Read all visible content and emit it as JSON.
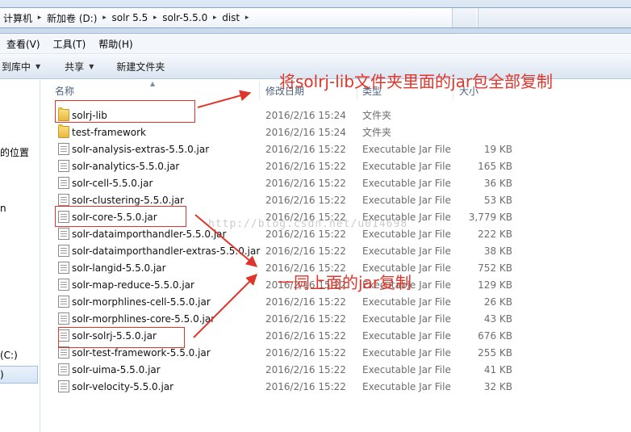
{
  "address_bar": {
    "crumbs": [
      "计算机",
      "新加卷 (D:)",
      "solr 5.5",
      "solr-5.5.0",
      "dist"
    ]
  },
  "menu": [
    "查看(V)",
    "工具(T)",
    "帮助(H)"
  ],
  "toolbar": {
    "include_in_library": "到库中",
    "share": "共享",
    "new_folder": "新建文件夹"
  },
  "nav_fragments": [
    "的位置",
    "n",
    "(C:)"
  ],
  "columns": {
    "name": "名称",
    "date": "修改日期",
    "type": "类型",
    "size": "大小"
  },
  "files": [
    {
      "name": "solrj-lib",
      "date": "2016/2/16 15:24",
      "type": "文件夹",
      "size": "",
      "kind": "folder"
    },
    {
      "name": "test-framework",
      "date": "2016/2/16 15:24",
      "type": "文件夹",
      "size": "",
      "kind": "folder"
    },
    {
      "name": "solr-analysis-extras-5.5.0.jar",
      "date": "2016/2/16 15:22",
      "type": "Executable Jar File",
      "size": "19 KB",
      "kind": "jar"
    },
    {
      "name": "solr-analytics-5.5.0.jar",
      "date": "2016/2/16 15:22",
      "type": "Executable Jar File",
      "size": "165 KB",
      "kind": "jar"
    },
    {
      "name": "solr-cell-5.5.0.jar",
      "date": "2016/2/16 15:22",
      "type": "Executable Jar File",
      "size": "36 KB",
      "kind": "jar"
    },
    {
      "name": "solr-clustering-5.5.0.jar",
      "date": "2016/2/16 15:22",
      "type": "Executable Jar File",
      "size": "53 KB",
      "kind": "jar"
    },
    {
      "name": "solr-core-5.5.0.jar",
      "date": "2016/2/16 15:22",
      "type": "Executable Jar File",
      "size": "3,779 KB",
      "kind": "jar"
    },
    {
      "name": "solr-dataimporthandler-5.5.0.jar",
      "date": "2016/2/16 15:22",
      "type": "Executable Jar File",
      "size": "222 KB",
      "kind": "jar"
    },
    {
      "name": "solr-dataimporthandler-extras-5.5.0.jar",
      "date": "2016/2/16 15:22",
      "type": "Executable Jar File",
      "size": "38 KB",
      "kind": "jar"
    },
    {
      "name": "solr-langid-5.5.0.jar",
      "date": "2016/2/16 15:22",
      "type": "Executable Jar File",
      "size": "752 KB",
      "kind": "jar"
    },
    {
      "name": "solr-map-reduce-5.5.0.jar",
      "date": "2016/2/16 15:22",
      "type": "Executable Jar File",
      "size": "129 KB",
      "kind": "jar"
    },
    {
      "name": "solr-morphlines-cell-5.5.0.jar",
      "date": "2016/2/16 15:22",
      "type": "Executable Jar File",
      "size": "26 KB",
      "kind": "jar"
    },
    {
      "name": "solr-morphlines-core-5.5.0.jar",
      "date": "2016/2/16 15:22",
      "type": "Executable Jar File",
      "size": "43 KB",
      "kind": "jar"
    },
    {
      "name": "solr-solrj-5.5.0.jar",
      "date": "2016/2/16 15:22",
      "type": "Executable Jar File",
      "size": "676 KB",
      "kind": "jar"
    },
    {
      "name": "solr-test-framework-5.5.0.jar",
      "date": "2016/2/16 15:22",
      "type": "Executable Jar File",
      "size": "255 KB",
      "kind": "jar"
    },
    {
      "name": "solr-uima-5.5.0.jar",
      "date": "2016/2/16 15:22",
      "type": "Executable Jar File",
      "size": "41 KB",
      "kind": "jar"
    },
    {
      "name": "solr-velocity-5.5.0.jar",
      "date": "2016/2/16 15:22",
      "type": "Executable Jar File",
      "size": "32 KB",
      "kind": "jar"
    }
  ],
  "annotations": {
    "top_note": "将solrj-lib文件夹里面的jar包全部复制",
    "mid_note": "一同上面的jar复制",
    "watermark": "http://blog.csdn.net/u014698",
    "color": "#e0352b"
  }
}
